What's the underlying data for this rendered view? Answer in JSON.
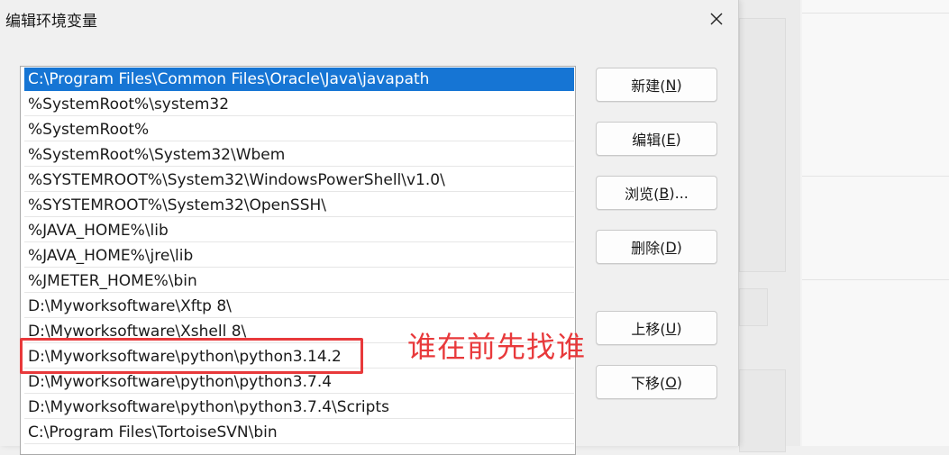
{
  "dialog": {
    "title": "编辑环境变量",
    "close_icon": "close-icon"
  },
  "path_list": {
    "selected_index": 0,
    "items": [
      "C:\\Program Files\\Common Files\\Oracle\\Java\\javapath",
      "%SystemRoot%\\system32",
      "%SystemRoot%",
      "%SystemRoot%\\System32\\Wbem",
      "%SYSTEMROOT%\\System32\\WindowsPowerShell\\v1.0\\",
      "%SYSTEMROOT%\\System32\\OpenSSH\\",
      "%JAVA_HOME%\\lib",
      "%JAVA_HOME%\\jre\\lib",
      "%JMETER_HOME%\\bin",
      "D:\\Myworksoftware\\Xftp 8\\",
      "D:\\Myworksoftware\\Xshell 8\\",
      "D:\\Myworksoftware\\python\\python3.14.2",
      "D:\\Myworksoftware\\python\\python3.7.4",
      "D:\\Myworksoftware\\python\\python3.7.4\\Scripts",
      "C:\\Program Files\\TortoiseSVN\\bin"
    ]
  },
  "buttons": {
    "new": {
      "label": "新建(",
      "key": "N",
      "end": ")"
    },
    "edit": {
      "label": "编辑(",
      "key": "E",
      "end": ")"
    },
    "browse": {
      "label": "浏览(",
      "key": "B",
      "end": ")..."
    },
    "delete": {
      "label": "删除(",
      "key": "D",
      "end": ")"
    },
    "move_up": {
      "label": "上移(",
      "key": "U",
      "end": ")"
    },
    "move_down": {
      "label": "下移(",
      "key": "O",
      "end": ")"
    }
  },
  "annotation": {
    "text": "谁在前先找谁",
    "color": "#e8393b"
  },
  "colors": {
    "selection": "#1675d4",
    "annotation_red": "#e8393b"
  }
}
